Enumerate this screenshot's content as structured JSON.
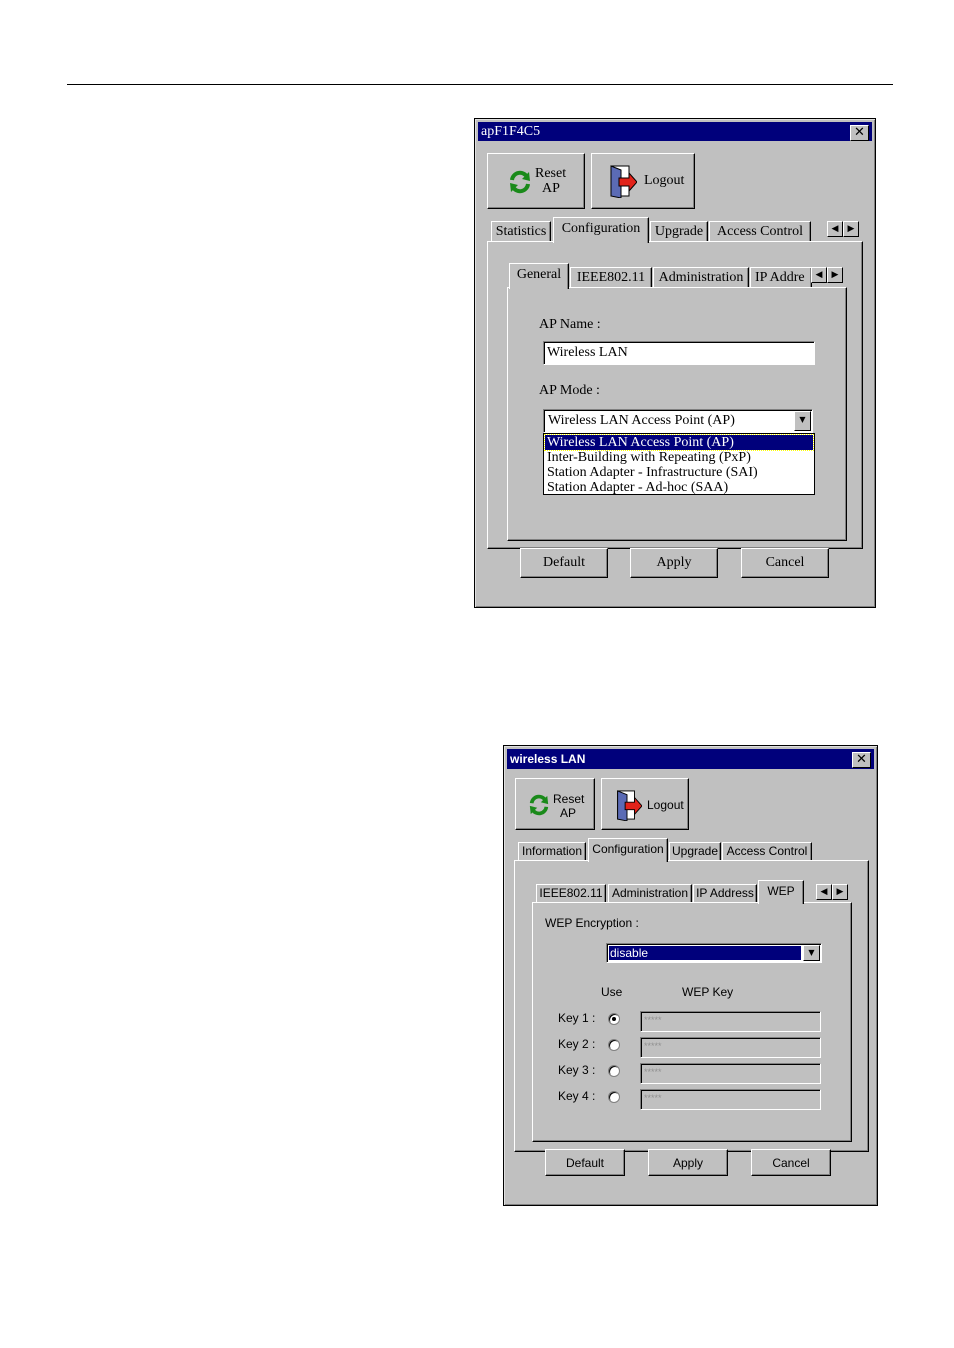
{
  "dialog1": {
    "title": "apF1F4C5",
    "reset_label_1": "Reset",
    "reset_label_2": "AP",
    "logout_label": "Logout",
    "tabs": [
      "Statistics",
      "Configuration",
      "Upgrade",
      "Access Control"
    ],
    "subtabs": [
      "General",
      "IEEE802.11",
      "Administration",
      "IP Addre"
    ],
    "ap_name_label": "AP Name :",
    "ap_name_value": "Wireless LAN",
    "ap_mode_label": "AP Mode :",
    "ap_mode_selected": "Wireless LAN Access Point (AP)",
    "ap_mode_options": [
      "Wireless LAN Access Point (AP)",
      "Inter-Building with Repeating (PxP)",
      "Station Adapter - Infrastructure (SAI)",
      "Station Adapter - Ad-hoc (SAA)"
    ],
    "default_label": "Default",
    "apply_label": "Apply",
    "cancel_label": "Cancel"
  },
  "dialog2": {
    "title": "wireless LAN",
    "reset_label_1": "Reset",
    "reset_label_2": "AP",
    "logout_label": "Logout",
    "tabs": [
      "Information",
      "Configuration",
      "Upgrade",
      "Access Control"
    ],
    "subtabs": [
      "IEEE802.11",
      "Administration",
      "IP Address",
      "WEP"
    ],
    "wep_encryption_label": "WEP Encryption :",
    "wep_encryption_value": "disable",
    "use_header": "Use",
    "wep_key_header": "WEP Key",
    "keys": [
      {
        "label": "Key 1 :",
        "value": "*****"
      },
      {
        "label": "Key 2 :",
        "value": "*****"
      },
      {
        "label": "Key 3 :",
        "value": "*****"
      },
      {
        "label": "Key 4 :",
        "value": "*****"
      }
    ],
    "default_label": "Default",
    "apply_label": "Apply",
    "cancel_label": "Cancel"
  }
}
